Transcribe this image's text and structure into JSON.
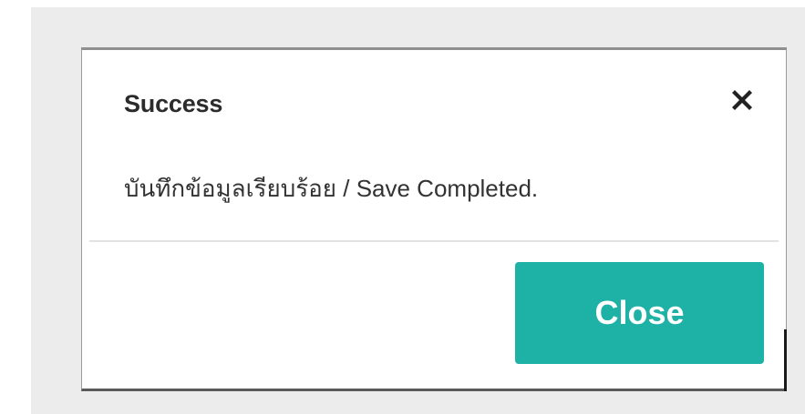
{
  "dialog": {
    "title": "Success",
    "message": "บันทึกข้อมูลเรียบร้อย / Save Completed.",
    "close_icon": "close-icon",
    "close_button_label": "Close"
  },
  "colors": {
    "backdrop": "#ececec",
    "button": "#1eb2a6",
    "button_text": "#ffffff",
    "title_text": "#2b2b2b",
    "message_text": "#333333"
  }
}
